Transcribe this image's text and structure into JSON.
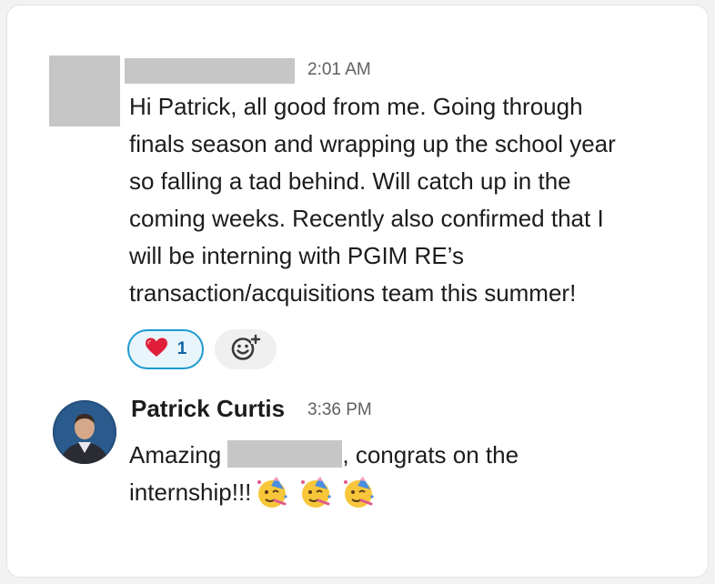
{
  "messages": [
    {
      "timestamp": "2:01 AM",
      "lines": [
        "Hi Patrick, all good from me. Going through",
        "finals season and wrapping up the school year",
        "so falling a tad behind. Will catch up in the",
        "coming weeks. Recently also confirmed that I",
        "will be interning with PGIM RE’s",
        "transaction/acquisitions team this summer!"
      ],
      "reactions": [
        {
          "emoji": "heart-emoji",
          "count": "1",
          "color": "#e01e5a"
        }
      ],
      "add_reaction_icon": "add-emoji-icon"
    },
    {
      "sender": "Patrick Curtis",
      "timestamp": "3:36 PM",
      "line1_before": "Amazing ",
      "line1_after": ", congrats on the",
      "line2": "internship!!!",
      "emojis": [
        "partying-face-emoji",
        "partying-face-emoji",
        "partying-face-emoji"
      ]
    }
  ],
  "colors": {
    "accent": "#1d9bd1",
    "text": "#1d1c1d",
    "muted": "#616061",
    "redaction": "#c6c6c6"
  }
}
